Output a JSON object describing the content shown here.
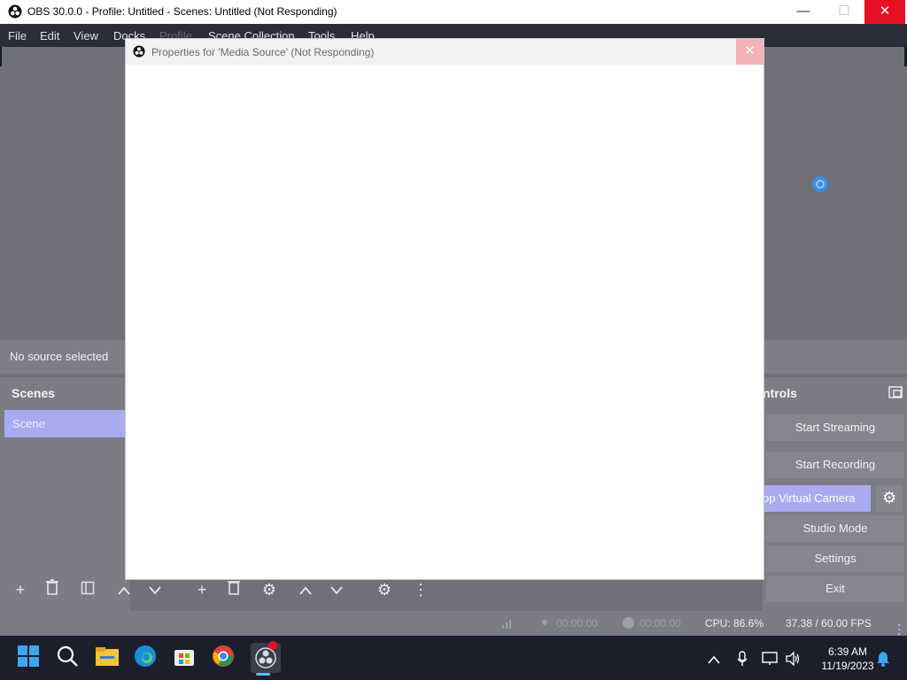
{
  "window": {
    "title": "OBS 30.0.0 - Profile: Untitled - Scenes: Untitled (Not Responding)",
    "minimize_glyph": "—",
    "maximize_glyph": "☐",
    "close_glyph": "✕"
  },
  "menu": {
    "items": [
      {
        "label": "File"
      },
      {
        "label": "Edit"
      },
      {
        "label": "View"
      },
      {
        "label": "Docks"
      },
      {
        "label": "Profile"
      },
      {
        "label": "Scene Collection"
      },
      {
        "label": "Tools"
      },
      {
        "label": "Help"
      }
    ]
  },
  "source_bar": {
    "label": "No source selected"
  },
  "scenes": {
    "title": "Scenes",
    "items": [
      {
        "label": "Scene",
        "selected": true
      }
    ]
  },
  "controls": {
    "title": "Controls",
    "visible_title": "ntrols",
    "start_streaming": "Start Streaming",
    "start_recording": "Start Recording",
    "virtual_camera": "Stop Virtual Camera",
    "virtual_camera_visible": "op Virtual Camera",
    "studio_mode": "Studio Mode",
    "settings": "Settings",
    "exit": "Exit"
  },
  "status": {
    "stream_time": "00:00:00",
    "record_time": "00:00:00",
    "cpu": "CPU: 86.6%",
    "fps": "37.38 / 60.00 FPS"
  },
  "dialog": {
    "title": "Properties for 'Media Source' (Not Responding)",
    "close_glyph": "✕"
  },
  "taskbar": {
    "time": "6:39 AM",
    "date": "11/19/2023",
    "icons": [
      "windows-start-icon",
      "search-icon",
      "file-explorer-icon",
      "edge-icon",
      "store-icon",
      "chrome-icon",
      "obs-icon"
    ]
  },
  "colors": {
    "accent": "#a8abf0",
    "close_red": "#e81123",
    "taskbar": "#1c1f2b"
  }
}
